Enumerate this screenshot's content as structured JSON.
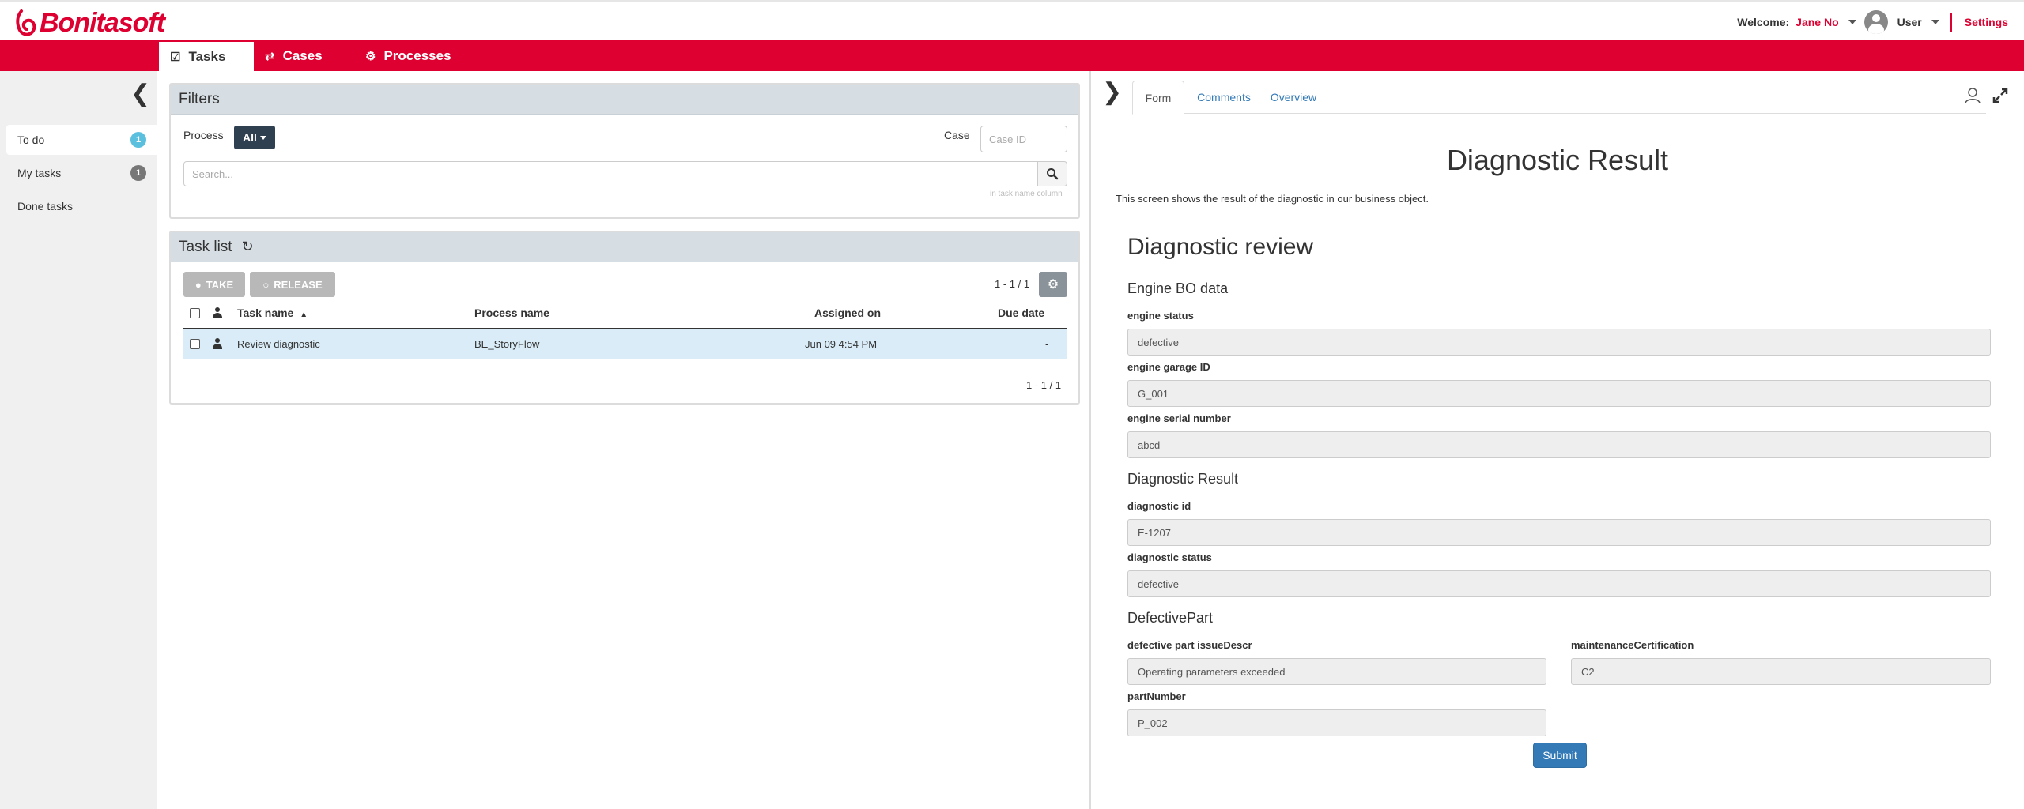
{
  "header": {
    "brand": "Bonitasoft",
    "welcome_label": "Welcome:",
    "username": "Jane No",
    "role": "User",
    "settings_label": "Settings",
    "accent_color": "#dd0031"
  },
  "nav": {
    "tabs": [
      {
        "label": "Tasks",
        "icon": "check-square-icon",
        "active": true
      },
      {
        "label": "Cases",
        "icon": "shuffle-icon",
        "active": false
      },
      {
        "label": "Processes",
        "icon": "cogs-icon",
        "active": false
      }
    ]
  },
  "sidebar": {
    "items": [
      {
        "label": "To do",
        "badge": "1",
        "badge_color": "#5bc0de",
        "active": true
      },
      {
        "label": "My tasks",
        "badge": "1",
        "badge_color": "#777777",
        "active": false
      },
      {
        "label": "Done tasks",
        "badge": "",
        "active": false
      }
    ]
  },
  "filters": {
    "title": "Filters",
    "process_label": "Process",
    "process_value": "All",
    "case_label": "Case",
    "case_placeholder": "Case ID",
    "search_placeholder": "Search...",
    "search_hint": "in task name column"
  },
  "tasklist": {
    "title": "Task list",
    "take_label": "TAKE",
    "release_label": "RELEASE",
    "pagination_top": "1 - 1 / 1",
    "pagination_bottom": "1 - 1 / 1",
    "columns": [
      "Task name",
      "Process name",
      "Assigned on",
      "Due date"
    ],
    "rows": [
      {
        "task": "Review diagnostic",
        "process": "BE_StoryFlow",
        "assigned": "Jun 09 4:54 PM",
        "due": "-"
      }
    ]
  },
  "right": {
    "tabs": [
      "Form",
      "Comments",
      "Overview"
    ],
    "form_title": "Diagnostic Result",
    "description": "This screen shows the result of the diagnostic in our business object.",
    "section_title": "Diagnostic review",
    "engine": {
      "heading": "Engine BO data",
      "fields": [
        {
          "label": "engine status",
          "value": "defective"
        },
        {
          "label": "engine garage ID",
          "value": "G_001"
        },
        {
          "label": "engine serial number",
          "value": "abcd"
        }
      ]
    },
    "diagnostic": {
      "heading": "Diagnostic Result",
      "fields": [
        {
          "label": "diagnostic id",
          "value": "E-1207"
        },
        {
          "label": "diagnostic status",
          "value": "defective"
        }
      ]
    },
    "defective": {
      "heading": "DefectivePart",
      "issue_label": "defective part issueDescr",
      "issue_value": "Operating parameters exceeded",
      "cert_label": "maintenanceCertification",
      "cert_value": "C2",
      "part_label": "partNumber",
      "part_value": "P_002"
    },
    "submit_label": "Submit"
  }
}
